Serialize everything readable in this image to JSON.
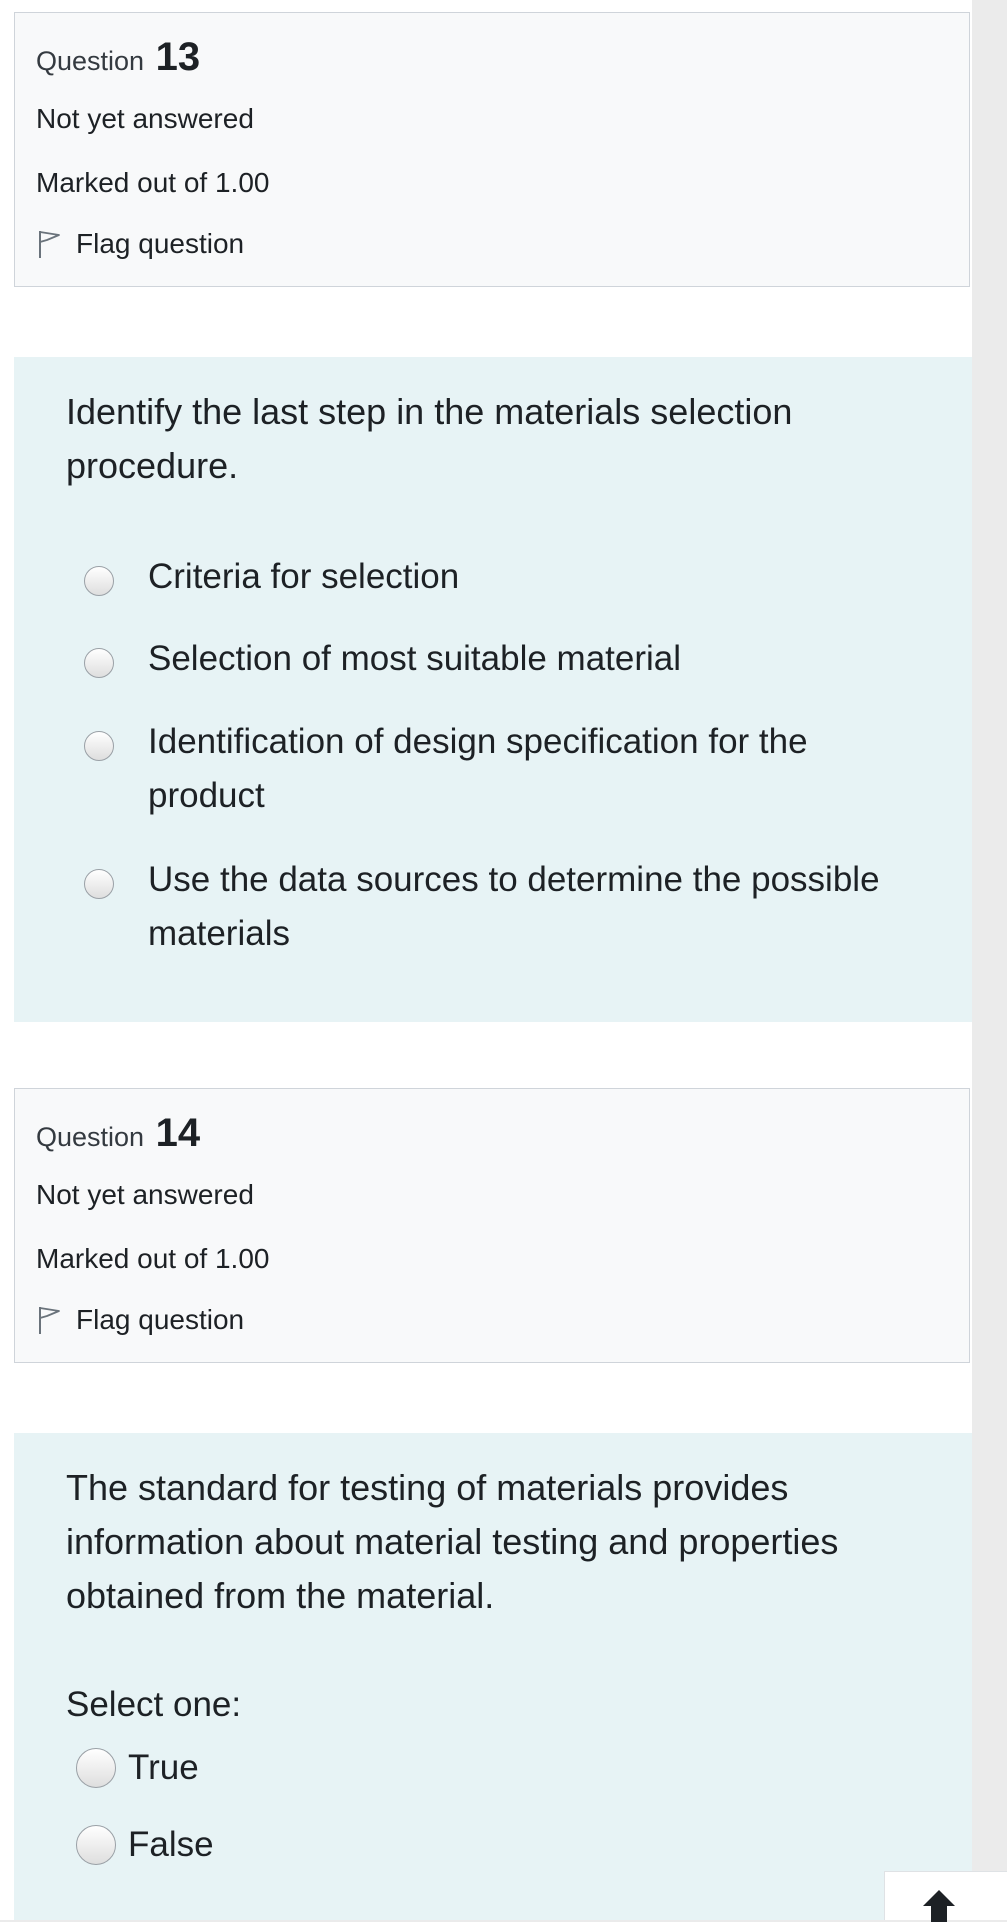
{
  "questions": [
    {
      "label": "Question",
      "number": "13",
      "state": "Not yet answered",
      "grade": "Marked out of 1.00",
      "flag": "Flag question",
      "text_lines": [
        "Identify the last step in the materials selection",
        "procedure."
      ],
      "options": [
        {
          "lines": [
            "Criteria for selection"
          ]
        },
        {
          "lines": [
            "Selection of most suitable material"
          ]
        },
        {
          "lines": [
            "Identification of design specification for the",
            "product"
          ]
        },
        {
          "lines": [
            "Use the data sources to determine the possible",
            "materials"
          ]
        }
      ]
    },
    {
      "label": "Question",
      "number": "14",
      "state": "Not yet answered",
      "grade": "Marked out of 1.00",
      "flag": "Flag question",
      "text_lines": [
        "The standard for testing of materials provides",
        "information about material testing and properties",
        "obtained from the material."
      ],
      "select_prompt": "Select one:",
      "options": [
        {
          "label": "True"
        },
        {
          "label": "False"
        }
      ]
    }
  ],
  "icons": {
    "flag": "flag-outline-icon",
    "back_to_top": "arrow-up-icon"
  },
  "colors": {
    "info_background": "#f8f9fa",
    "content_background": "#e7f3f5",
    "text": "#1d2125"
  }
}
